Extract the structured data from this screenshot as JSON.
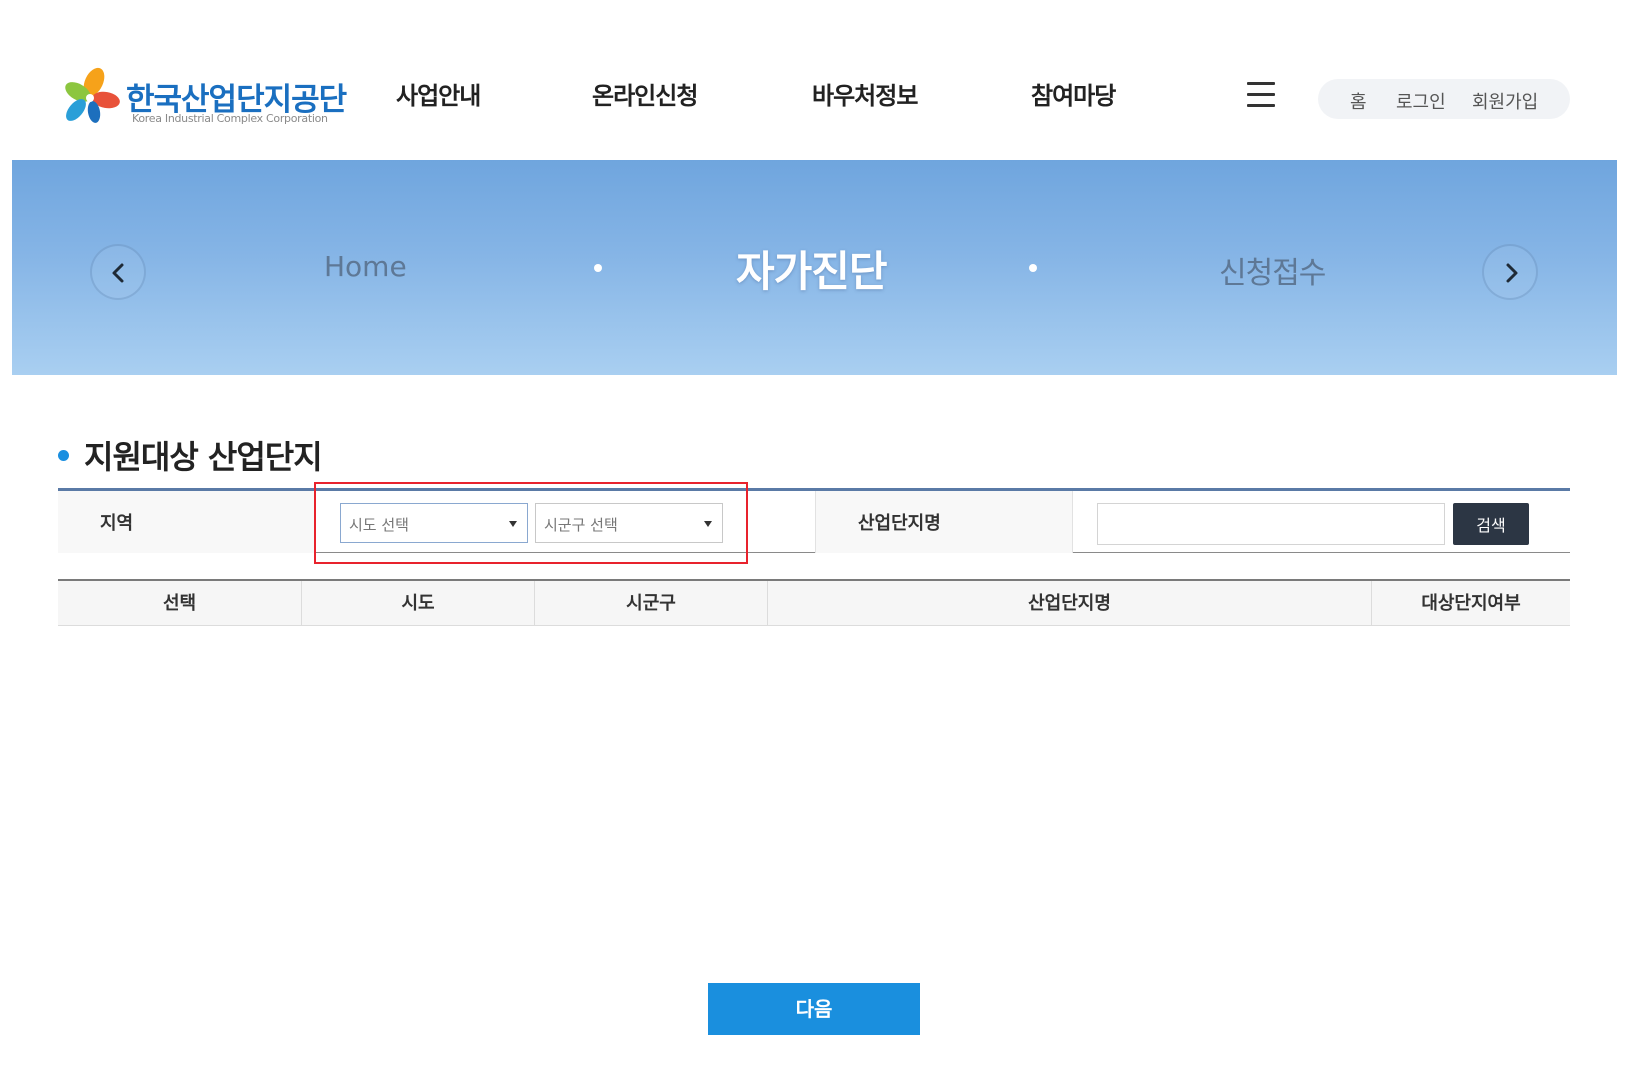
{
  "header": {
    "logo": {
      "name_ko": "한국산업단지공단",
      "name_en": "Korea Industrial Complex Corporation"
    },
    "nav": [
      "사업안내",
      "온라인신청",
      "바우처정보",
      "참여마당"
    ],
    "menu_icon": "hamburger-menu-icon",
    "util_links": [
      "홈",
      "로그인",
      "회원가입"
    ]
  },
  "hero": {
    "prev_icon": "chevron-left-icon",
    "next_icon": "chevron-right-icon",
    "breadcrumb": {
      "home": "Home",
      "current": "자가진단",
      "next": "신청접수"
    }
  },
  "section": {
    "title": "지원대상 산업단지"
  },
  "search": {
    "region_label": "지역",
    "sido_select": {
      "value": "시도 선택"
    },
    "sigungu_select": {
      "value": "시군구 선택"
    },
    "complex_label": "산업단지명",
    "complex_input": {
      "value": "",
      "placeholder": ""
    },
    "search_button": "검색"
  },
  "table": {
    "columns": [
      "선택",
      "시도",
      "시군구",
      "산업단지명",
      "대상단지여부"
    ],
    "rows": []
  },
  "actions": {
    "next_button": "다음"
  },
  "colors": {
    "brand_blue": "#1a6fc0",
    "accent_blue": "#1a8fde",
    "highlight_red": "#e8232d",
    "dark_button": "#2c3644"
  }
}
